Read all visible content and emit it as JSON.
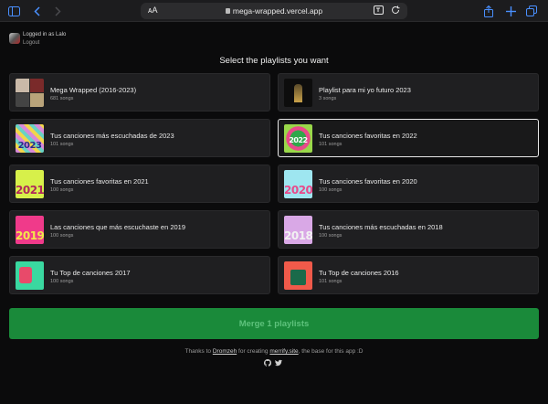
{
  "browser": {
    "url_aa": "ᴀA",
    "url": "mega-wrapped.vercel.app"
  },
  "user": {
    "logged_in_text": "Logged in as Lalo",
    "logout_label": "Logout"
  },
  "heading": "Select the playlists you want",
  "playlists": [
    {
      "name": "Mega Wrapped (2016-2023)",
      "count": "681 songs",
      "year": "",
      "selected": false
    },
    {
      "name": "Playlist para mi yo futuro 2023",
      "count": "3 songs",
      "year": "",
      "selected": false
    },
    {
      "name": "Tus canciones más escuchadas de 2023",
      "count": "101 songs",
      "year": "2023",
      "selected": false
    },
    {
      "name": "Tus canciones favoritas en 2022",
      "count": "101 songs",
      "year": "2022",
      "selected": true
    },
    {
      "name": "Tus canciones favoritas en 2021",
      "count": "100 songs",
      "year": "2021",
      "selected": false
    },
    {
      "name": "Tus canciones favoritas en 2020",
      "count": "100 songs",
      "year": "2020",
      "selected": false
    },
    {
      "name": "Las canciones que más escuchaste en 2019",
      "count": "100 songs",
      "year": "2019",
      "selected": false
    },
    {
      "name": "Tus canciones más escuchadas en 2018",
      "count": "100 songs",
      "year": "2018",
      "selected": false
    },
    {
      "name": "Tu Top de canciones 2017",
      "count": "100 songs",
      "year": "",
      "selected": false
    },
    {
      "name": "Tu Top de canciones 2016",
      "count": "101 songs",
      "year": "",
      "selected": false
    }
  ],
  "merge_label": "Merge 1 playlists",
  "footer": {
    "prefix": "Thanks to ",
    "author": "Dromzeh",
    "middle": " for creating ",
    "site": "merrify.site",
    "suffix": ", the base for this app :D"
  },
  "colors": {
    "accent": "#1a8a3a",
    "selected_border": "#e8e8e8"
  }
}
